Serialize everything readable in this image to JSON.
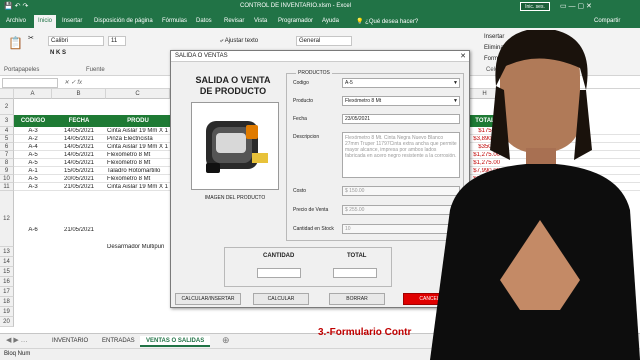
{
  "window": {
    "title": "CONTROL DE INVENTARIO.xlsm - Excel",
    "signin": "Inic. ses."
  },
  "ribbon_tabs": [
    "Archivo",
    "Inicio",
    "Insertar",
    "Disposición de página",
    "Fórmulas",
    "Datos",
    "Revisar",
    "Vista",
    "Programador",
    "Ayuda",
    "¿Qué desea hacer?",
    "Compartir"
  ],
  "ribbon": {
    "font_name": "Calibri",
    "font_size": "11",
    "wrap_text": "Ajustar texto",
    "number_format": "General",
    "insert": "Insertar",
    "delete": "Eliminar",
    "format": "Formato",
    "groups": [
      "Portapapeles",
      "Fuente",
      "Celdas"
    ]
  },
  "columns": [
    "A",
    "B",
    "C",
    "H"
  ],
  "table": {
    "headers": [
      "CODIGO",
      "FECHA",
      "PRODU",
      "TOTAL"
    ],
    "rows": [
      [
        "A-3",
        "14/05/2021",
        "Cinta Aislar 19 Mm X 1",
        "$175.00"
      ],
      [
        "A-2",
        "14/05/2021",
        "Pinza Electricista",
        "$3,890.00"
      ],
      [
        "A-4",
        "14/05/2021",
        "Cinta Aislar 19 Mm X 1",
        "$350.00"
      ],
      [
        "A-5",
        "14/05/2021",
        "Flexómetro 8 Mt",
        "$1,275.00"
      ],
      [
        "A-5",
        "14/05/2021",
        "Flexómetro 8 Mt",
        "$1,275.00"
      ],
      [
        "A-1",
        "15/05/2021",
        "Taladro Rotomartillo",
        "$7,990.00"
      ],
      [
        "A-5",
        "20/05/2021",
        "Flexómetro 8 Mt",
        "$1,215.00"
      ],
      [
        "A-3",
        "21/05/2021",
        "Cinta Aislar 19 Mm X 1",
        "$175.00"
      ]
    ],
    "row_a6": [
      "A-6",
      "21/05/2021",
      "Desarmador Multipun"
    ],
    "row_numbers": [
      "2",
      "3",
      "4",
      "5",
      "6",
      "7",
      "8",
      "9",
      "10",
      "11",
      "12",
      "13",
      "14",
      "15",
      "16",
      "17",
      "18",
      "19",
      "20"
    ]
  },
  "sheet_tabs": [
    "INVENTARIO",
    "ENTRADAS",
    "VENTAS O SALIDAS"
  ],
  "status": "Bloq Num",
  "dialog": {
    "title": "SALIDA O VENTAS",
    "heading": "SALIDA O VENTA DE PRODUCTO",
    "image_label": "IMAGEN DEL PRODUCTO",
    "section": "PRODUCTOS",
    "fields": {
      "codigo": {
        "label": "Codigo",
        "value": "A-5"
      },
      "producto": {
        "label": "Producto",
        "value": "Flexómetro 8 Mt"
      },
      "fecha": {
        "label": "Fecha",
        "value": "23/05/2021"
      },
      "descripcion": {
        "label": "Descripcion",
        "value": "Flexómetro 8 Mt. Cinta Negra Nuevo Blanco 27mm Truper 11797Cinta extra ancha que permite mayor alcance, impresa por ambos lados fabricada en acero negro resistente a la corrosión."
      },
      "costo": {
        "label": "Costo",
        "value": "$ 150.00"
      },
      "precio": {
        "label": "Precio de Venta",
        "value": "$ 255.00"
      },
      "stock": {
        "label": "Cantidad en Stock",
        "value": "10"
      }
    },
    "cantidad_label": "CANTIDAD",
    "total_label": "TOTAL",
    "buttons": [
      "CALCULAR/INSERTAR",
      "CALCULAR",
      "BORRAR",
      "CANCELAR"
    ]
  },
  "caption": "3.-Formulario Contr",
  "colors": {
    "excel_green": "#217346",
    "header_green": "#1e7a34",
    "cancel_red": "#e00000",
    "total_red": "#c00000"
  }
}
